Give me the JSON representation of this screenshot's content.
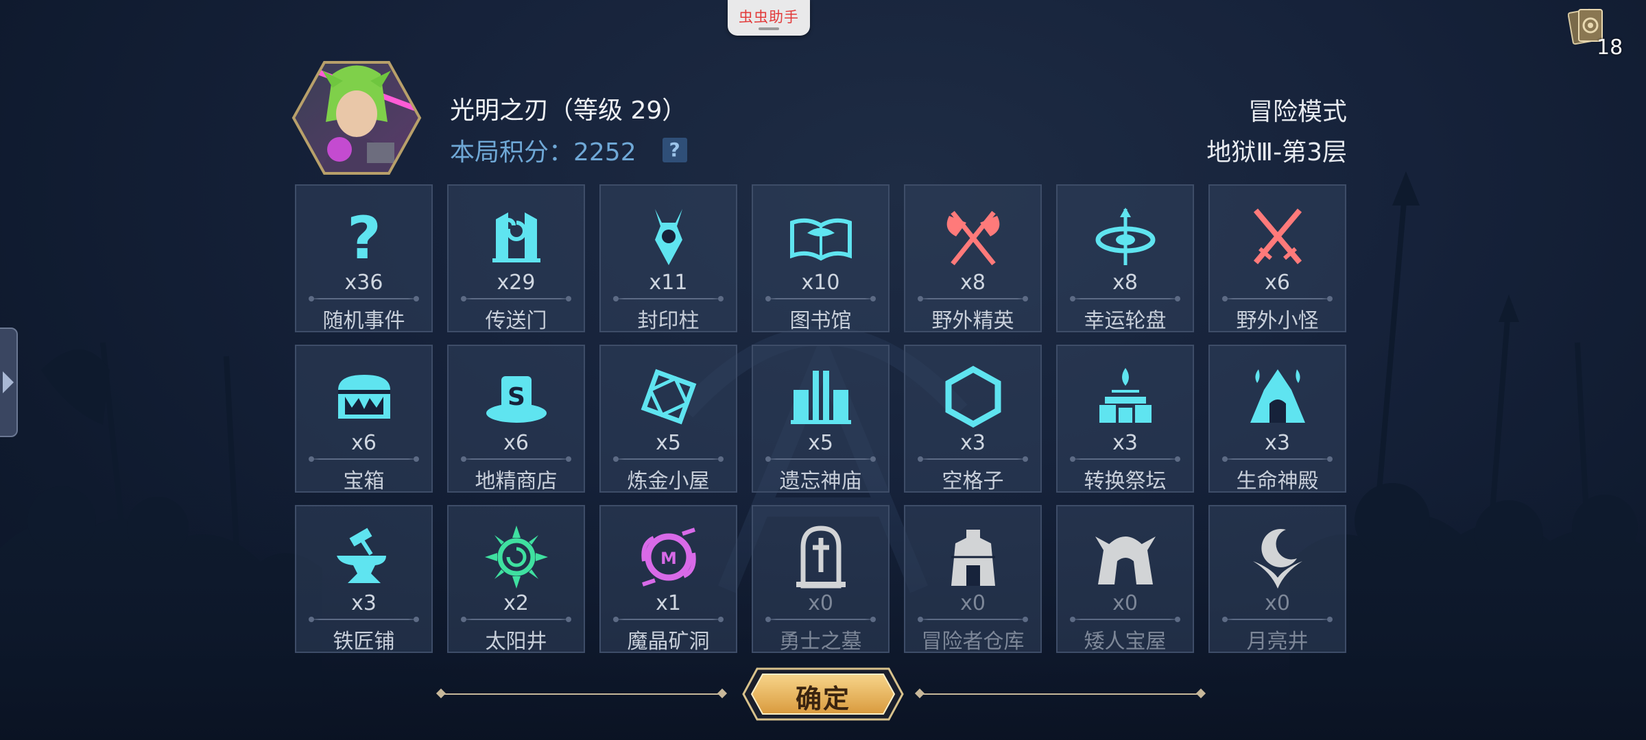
{
  "helper": {
    "label": "虫虫助手"
  },
  "deck": {
    "count": "18"
  },
  "player": {
    "name": "光明之刃（等级 29）",
    "score_text": "本局积分：2252",
    "help_label": "?"
  },
  "mode": {
    "label": "冒险模式",
    "floor": "地狱Ⅲ-第3层"
  },
  "tiles": [
    {
      "icon": "question-icon",
      "count": "x36",
      "label": "随机事件",
      "color": "#5fe4f0"
    },
    {
      "icon": "portal-icon",
      "count": "x29",
      "label": "传送门",
      "color": "#5fe4f0"
    },
    {
      "icon": "seal-pillar-icon",
      "count": "x11",
      "label": "封印柱",
      "color": "#5fe4f0"
    },
    {
      "icon": "open-book-icon",
      "count": "x10",
      "label": "图书馆",
      "color": "#5fe4f0"
    },
    {
      "icon": "crossed-axes-icon",
      "count": "x8",
      "label": "野外精英",
      "color": "#ff7a7a"
    },
    {
      "icon": "wheel-icon",
      "count": "x8",
      "label": "幸运轮盘",
      "color": "#5fe4f0"
    },
    {
      "icon": "crossed-swords-icon",
      "count": "x6",
      "label": "野外小怪",
      "color": "#ff7a7a"
    },
    {
      "icon": "treasure-chest-icon",
      "count": "x6",
      "label": "宝箱",
      "color": "#5fe4f0"
    },
    {
      "icon": "hat-shop-icon",
      "count": "x6",
      "label": "地精商店",
      "color": "#5fe4f0"
    },
    {
      "icon": "alchemy-icon",
      "count": "x5",
      "label": "炼金小屋",
      "color": "#5fe4f0"
    },
    {
      "icon": "temple-icon",
      "count": "x5",
      "label": "遗忘神庙",
      "color": "#5fe4f0"
    },
    {
      "icon": "hexagon-icon",
      "count": "x3",
      "label": "空格子",
      "color": "#5fe4f0"
    },
    {
      "icon": "altar-icon",
      "count": "x3",
      "label": "转换祭坛",
      "color": "#5fe4f0"
    },
    {
      "icon": "life-shrine-icon",
      "count": "x3",
      "label": "生命神殿",
      "color": "#5fe4f0"
    },
    {
      "icon": "anvil-icon",
      "count": "x3",
      "label": "铁匠铺",
      "color": "#5fe4f0"
    },
    {
      "icon": "sun-well-icon",
      "count": "x2",
      "label": "太阳井",
      "color": "#3fe0a0"
    },
    {
      "icon": "crystal-mine-icon",
      "count": "x1",
      "label": "魔晶矿洞",
      "color": "#d86ae8"
    },
    {
      "icon": "tomb-icon",
      "count": "x0",
      "label": "勇士之墓",
      "color": "#e6e6e6"
    },
    {
      "icon": "warehouse-icon",
      "count": "x0",
      "label": "冒险者仓库",
      "color": "#e6e6e6"
    },
    {
      "icon": "dwarf-house-icon",
      "count": "x0",
      "label": "矮人宝屋",
      "color": "#e6e6e6"
    },
    {
      "icon": "moon-well-icon",
      "count": "x0",
      "label": "月亮井",
      "color": "#e6e6e6"
    }
  ],
  "confirm": {
    "label": "确定"
  }
}
